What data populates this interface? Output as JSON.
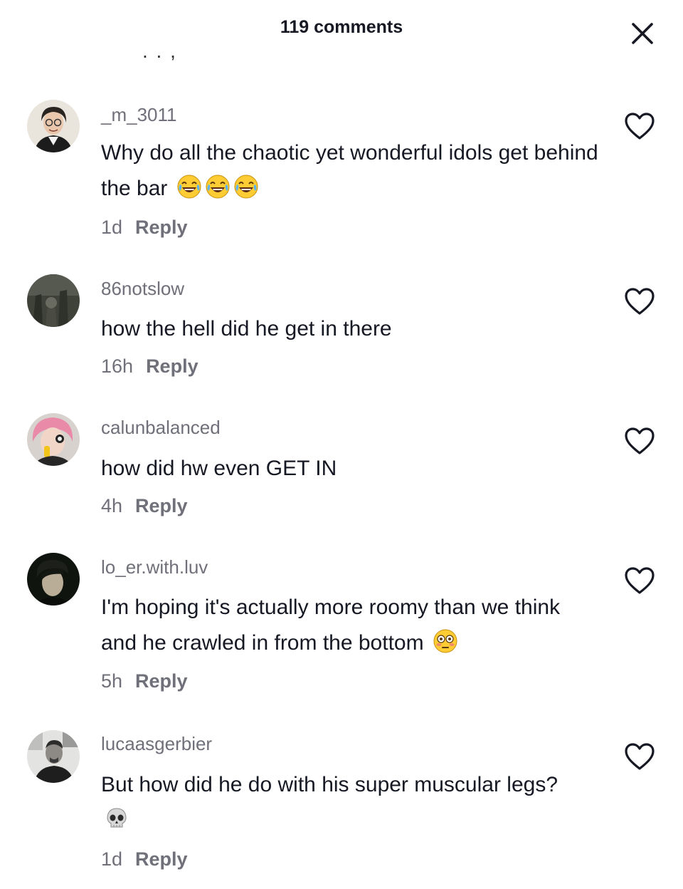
{
  "header": {
    "title": "119 comments"
  },
  "comments": [
    {
      "username": "_m_3011",
      "text": "Why do all the chaotic yet wonderful idols get behind the bar",
      "time": "1d",
      "reply": "Reply"
    },
    {
      "username": "86notslow",
      "text": "how the hell did he get in there",
      "time": "16h",
      "reply": "Reply"
    },
    {
      "username": "calunbalanced",
      "text": "how did hw even GET IN",
      "time": "4h",
      "reply": "Reply"
    },
    {
      "username": "lo_er.with.luv",
      "text": "I'm hoping it's actually more roomy than we think and he crawled in from the bottom",
      "time": "5h",
      "reply": "Reply"
    },
    {
      "username": "lucaasgerbier",
      "text": "But how did he do with his super muscular legs?",
      "time": "1d",
      "reply": "Reply"
    }
  ],
  "icons": {
    "close": "close-icon",
    "like": "heart-outline-icon",
    "emoji_laugh": "tears-of-joy-emoji",
    "emoji_flushed": "flushed-face-emoji",
    "emoji_skull": "skull-emoji"
  },
  "colors": {
    "primary_text": "#161823",
    "secondary_text": "#6f7079",
    "background": "#ffffff"
  }
}
